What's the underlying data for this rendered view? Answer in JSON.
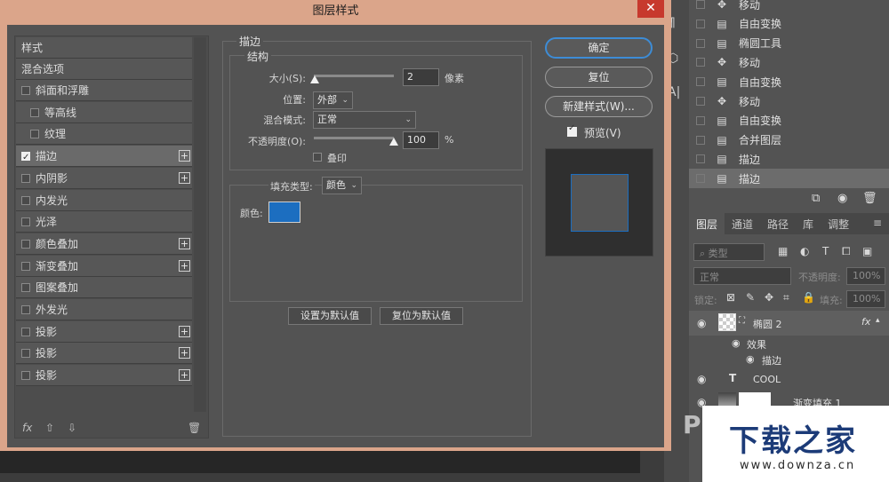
{
  "dialog": {
    "title": "图层样式",
    "close_glyph": "✕"
  },
  "style_list": {
    "header": "样式",
    "blend_options": "混合选项",
    "items": [
      {
        "label": "斜面和浮雕",
        "checked": false,
        "indent": false,
        "plus": false
      },
      {
        "label": "等高线",
        "checked": false,
        "indent": true,
        "plus": false
      },
      {
        "label": "纹理",
        "checked": false,
        "indent": true,
        "plus": false
      },
      {
        "label": "描边",
        "checked": true,
        "indent": false,
        "plus": true,
        "selected": true
      },
      {
        "label": "内阴影",
        "checked": false,
        "indent": false,
        "plus": true
      },
      {
        "label": "内发光",
        "checked": false,
        "indent": false,
        "plus": false
      },
      {
        "label": "光泽",
        "checked": false,
        "indent": false,
        "plus": false
      },
      {
        "label": "颜色叠加",
        "checked": false,
        "indent": false,
        "plus": true
      },
      {
        "label": "渐变叠加",
        "checked": false,
        "indent": false,
        "plus": true
      },
      {
        "label": "图案叠加",
        "checked": false,
        "indent": false,
        "plus": false
      },
      {
        "label": "外发光",
        "checked": false,
        "indent": false,
        "plus": false
      },
      {
        "label": "投影",
        "checked": false,
        "indent": false,
        "plus": true
      },
      {
        "label": "投影",
        "checked": false,
        "indent": false,
        "plus": true
      },
      {
        "label": "投影",
        "checked": false,
        "indent": false,
        "plus": true
      }
    ],
    "footer": {
      "fx": "fx",
      "up": "⇧",
      "down": "⇩",
      "trash": "🗑"
    }
  },
  "stroke": {
    "section_title": "描边",
    "structure_title": "结构",
    "size_label": "大小(S):",
    "size_value": "2",
    "size_unit": "像素",
    "position_label": "位置:",
    "position_value": "外部",
    "blend_label": "混合模式:",
    "blend_value": "正常",
    "opacity_label": "不透明度(O):",
    "opacity_value": "100",
    "opacity_unit": "%",
    "overprint_label": "叠印",
    "fill_type_label": "填充类型:",
    "fill_type_value": "颜色",
    "color_label": "颜色:",
    "color_hex": "#1c6ec0",
    "size_fraction": 0.01,
    "opacity_fraction": 1.0
  },
  "defaults": {
    "set_default": "设置为默认值",
    "reset_default": "复位为默认值"
  },
  "right_buttons": {
    "ok": "确定",
    "reset": "复位",
    "new_style": "新建样式(W)...",
    "preview": "预览(V)"
  },
  "history": {
    "rows": [
      {
        "icon": "move-icon",
        "label": "移动"
      },
      {
        "icon": "doc-icon",
        "label": "自由变换"
      },
      {
        "icon": "doc-icon",
        "label": "椭圆工具"
      },
      {
        "icon": "move-icon",
        "label": "移动"
      },
      {
        "icon": "doc-icon",
        "label": "自由变换"
      },
      {
        "icon": "move-icon",
        "label": "移动"
      },
      {
        "icon": "doc-icon",
        "label": "自由变换"
      },
      {
        "icon": "doc-icon",
        "label": "合并图层"
      },
      {
        "icon": "doc-icon",
        "label": "描边"
      },
      {
        "icon": "doc-icon",
        "label": "描边",
        "selected": true
      }
    ]
  },
  "layers": {
    "tabs": [
      "图层",
      "通道",
      "路径",
      "库",
      "调整"
    ],
    "filter_placeholder": "类型",
    "blend_mode": "正常",
    "opacity_label": "不透明度:",
    "opacity_value": "100%",
    "lock_label": "锁定:",
    "fill_label": "填充:",
    "fill_value": "100%",
    "rows": {
      "ellipse": "椭圆 2",
      "fx": "fx",
      "effects": "效果",
      "stroke": "描边",
      "text_type": "T",
      "text_layer": "COOL",
      "gradient": "渐变填充 1"
    }
  },
  "watermark": {
    "main": "下载之家",
    "url": "www.downza.cn",
    "letter": "P"
  }
}
